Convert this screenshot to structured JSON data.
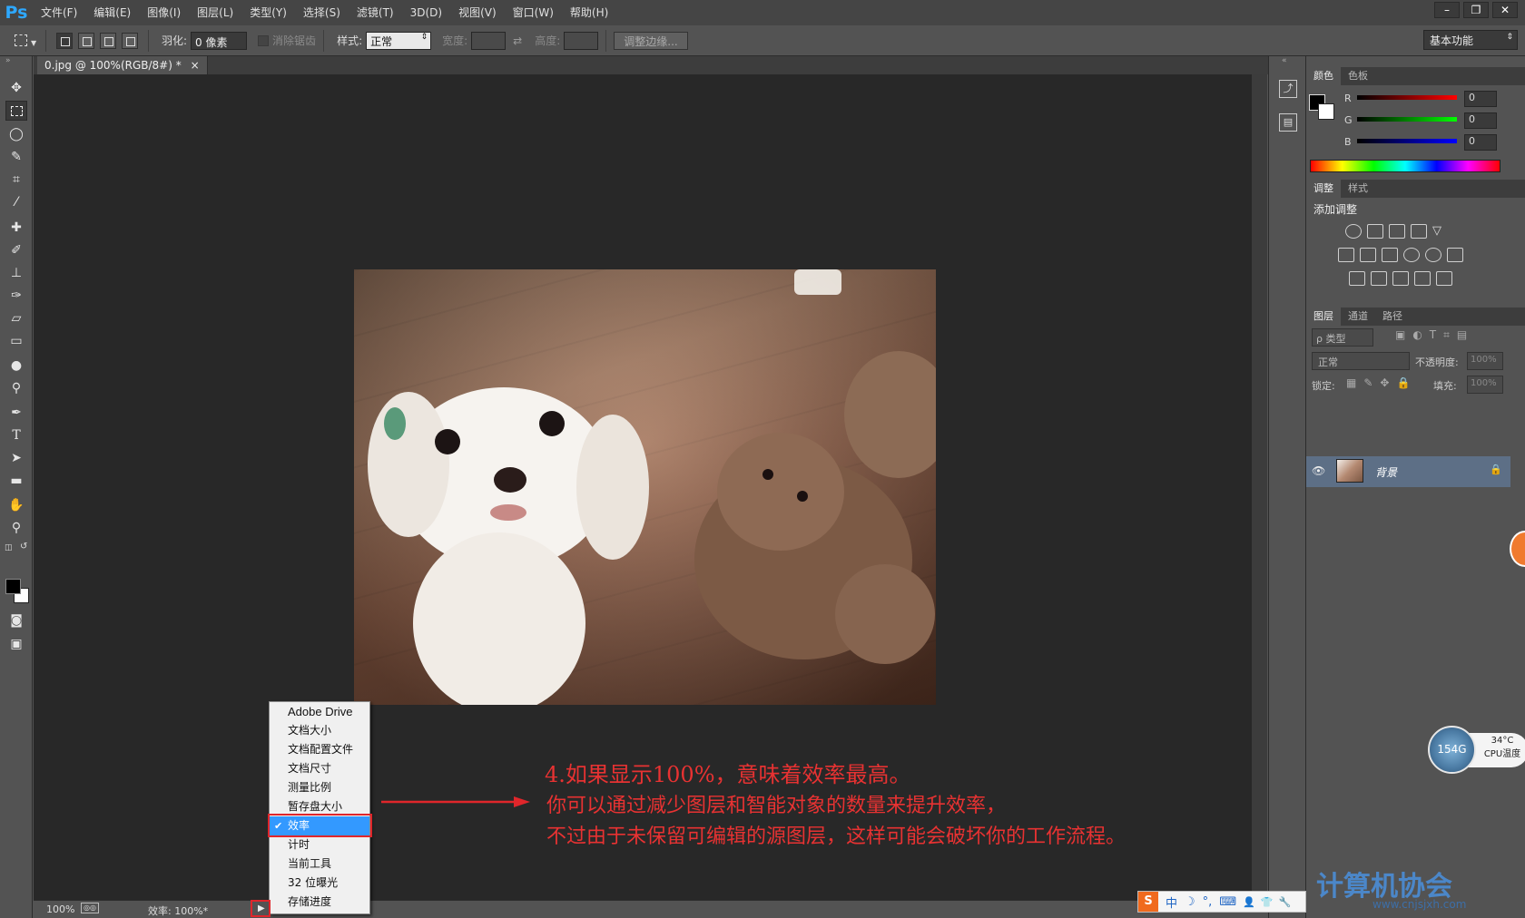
{
  "app": {
    "logo": "Ps"
  },
  "menu": [
    "文件(F)",
    "编辑(E)",
    "图像(I)",
    "图层(L)",
    "类型(Y)",
    "选择(S)",
    "滤镜(T)",
    "3D(D)",
    "视图(V)",
    "窗口(W)",
    "帮助(H)"
  ],
  "window_buttons": [
    "–",
    "❐",
    "✕"
  ],
  "options": {
    "feather_label": "羽化:",
    "feather_value": "0 像素",
    "antialias_label": "消除锯齿",
    "style_label": "样式:",
    "style_value": "正常",
    "width_label": "宽度:",
    "height_label": "高度:",
    "refine_button": "调整边缘...",
    "workspace": "基本功能"
  },
  "document": {
    "tab_title": "0.jpg @ 100%(RGB/8#) *",
    "close": "×"
  },
  "status": {
    "zoom": "100%",
    "efficiency": "效率: 100%*"
  },
  "popup_menu": {
    "items": [
      "Adobe Drive",
      "文档大小",
      "文档配置文件",
      "文档尺寸",
      "测量比例",
      "暂存盘大小",
      "效率",
      "计时",
      "当前工具",
      "32 位曝光",
      "存储进度"
    ],
    "selected": "效率",
    "check": "✔"
  },
  "annotation": {
    "line1": "4.如果显示100%，意味着效率最高。",
    "line2": "你可以通过减少图层和智能对象的数量来提升效率，",
    "line3": "不过由于未保留可编辑的源图层，这样可能会破坏你的工作流程。"
  },
  "color_panel": {
    "tabs": [
      "颜色",
      "色板"
    ],
    "channels": [
      {
        "name": "R",
        "value": "0"
      },
      {
        "name": "G",
        "value": "0"
      },
      {
        "name": "B",
        "value": "0"
      }
    ]
  },
  "adjust_panel": {
    "tabs": [
      "调整",
      "样式"
    ],
    "title": "添加调整"
  },
  "layers_panel": {
    "tabs": [
      "图层",
      "通道",
      "路径"
    ],
    "filter_label": "ρ 类型",
    "blend_mode": "正常",
    "opacity_label": "不透明度:",
    "opacity_value": "100%",
    "lock_label": "锁定:",
    "fill_label": "填充:",
    "fill_value": "100%",
    "layer_name": "背景"
  },
  "widgets": {
    "ball_value": "154G",
    "cpu_temp": "34°C",
    "cpu_label": "CPU温度"
  },
  "ime": {
    "items": [
      "S",
      "中",
      "☽",
      "°,",
      "⌨",
      "👤",
      "👕",
      "🔧"
    ]
  },
  "watermark": {
    "text": "计算机协会",
    "url": "www.cnjsjxh.com"
  }
}
